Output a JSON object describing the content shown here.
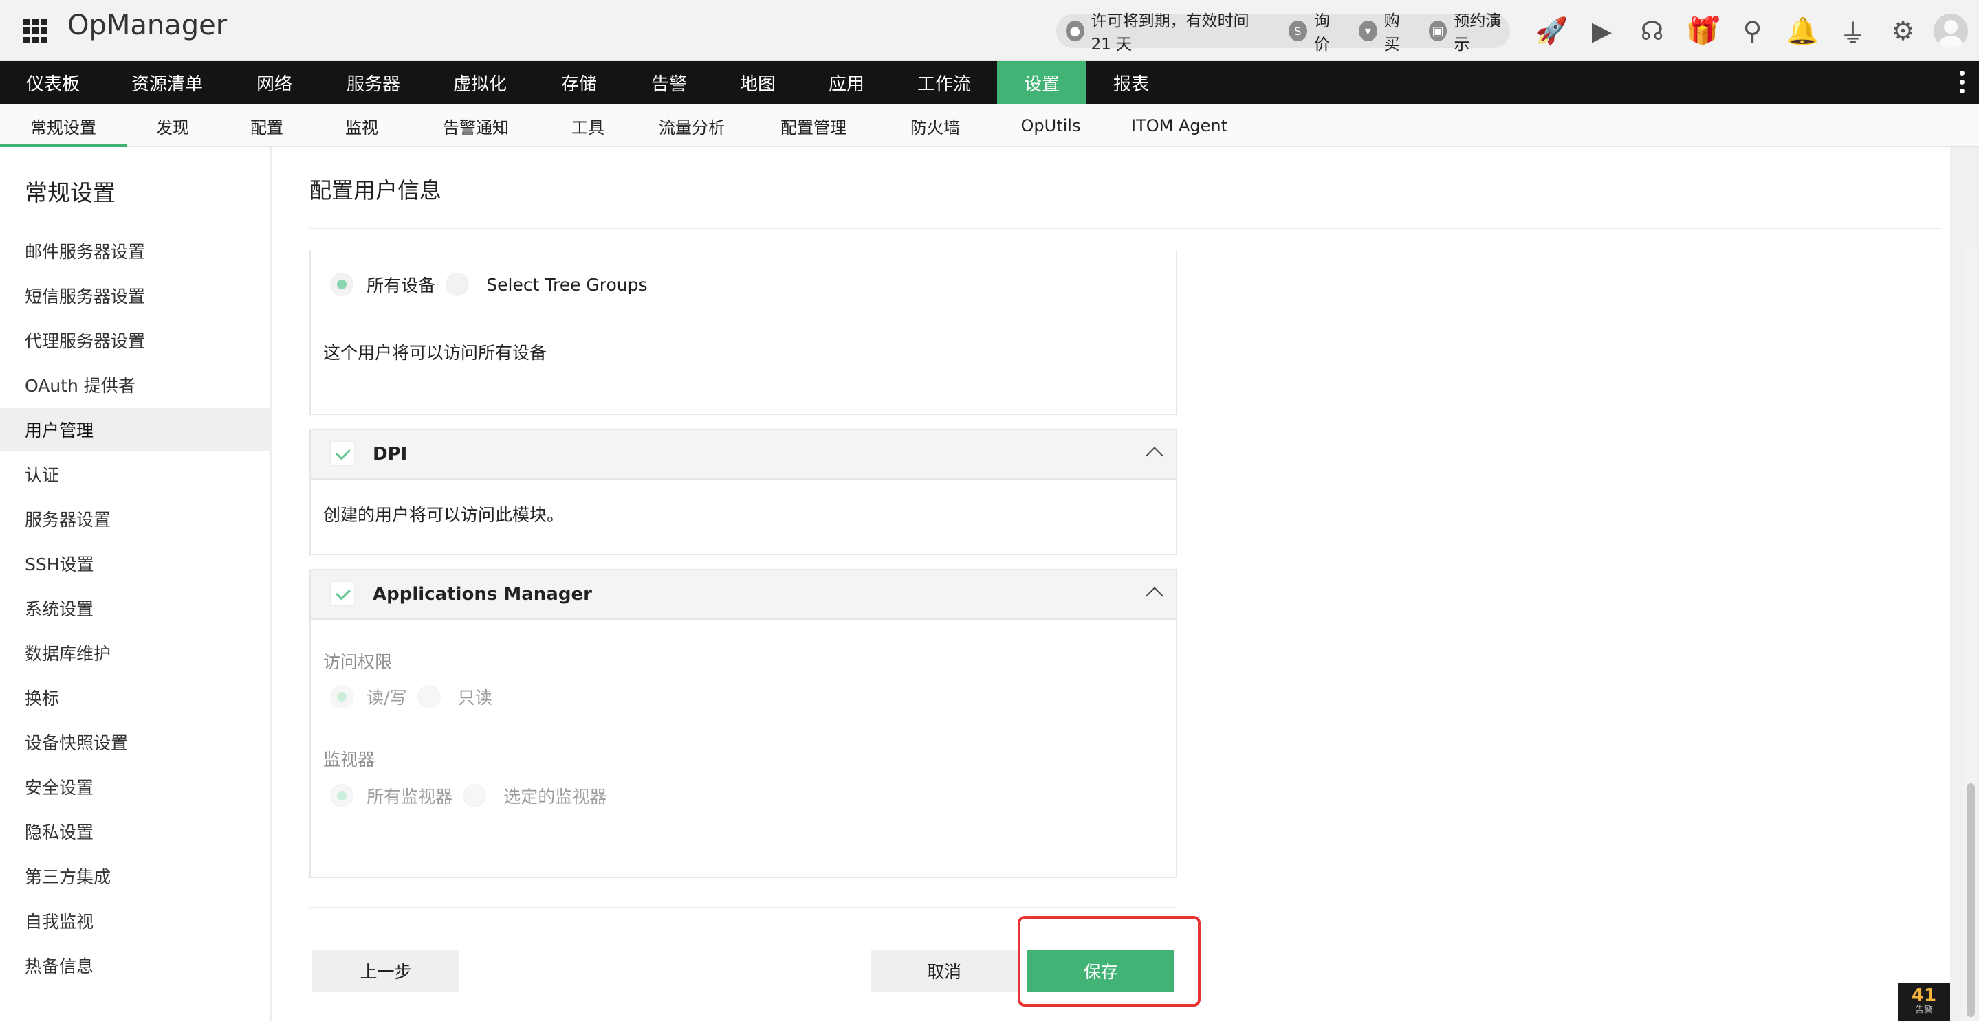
{
  "app": {
    "name": "OpManager"
  },
  "license": {
    "message": "许可将到期，有效时间 21 天",
    "links": [
      "询价",
      "购买",
      "预约演示"
    ],
    "icons": [
      "user-badge-icon",
      "dollar-icon",
      "cart-icon",
      "demo-icon"
    ]
  },
  "top_icons": [
    "rocket-icon",
    "presentation-icon",
    "headset-icon",
    "gift-icon",
    "search-icon",
    "bell-icon",
    "plug-icon",
    "gear-icon",
    "user-avatar-icon"
  ],
  "main_nav": [
    {
      "label": "仪表板",
      "w": 154
    },
    {
      "label": "资源清单",
      "w": 178
    },
    {
      "label": "网络",
      "w": 134
    },
    {
      "label": "服务器",
      "w": 154
    },
    {
      "label": "虚拟化",
      "w": 156
    },
    {
      "label": "存储",
      "w": 132
    },
    {
      "label": "告警",
      "w": 130
    },
    {
      "label": "地图",
      "w": 128
    },
    {
      "label": "应用",
      "w": 130
    },
    {
      "label": "工作流",
      "w": 154
    },
    {
      "label": "设置",
      "w": 130
    },
    {
      "label": "报表",
      "w": 130
    }
  ],
  "main_nav_active": "设置",
  "sub_nav": [
    "常规设置",
    "发现",
    "配置",
    "监视",
    "告警通知",
    "工具",
    "流量分析",
    "配置管理",
    "防火墙",
    "OpUtils",
    "ITOM Agent"
  ],
  "sub_nav_active": "常规设置",
  "sidebar": {
    "title": "常规设置",
    "items": [
      "邮件服务器设置",
      "短信服务器设置",
      "代理服务器设置",
      "OAuth 提供者",
      "用户管理",
      "认证",
      "服务器设置",
      "SSH设置",
      "系统设置",
      "数据库维护",
      "换标",
      "设备快照设置",
      "安全设置",
      "隐私设置",
      "第三方集成",
      "自我监视",
      "热备信息"
    ],
    "active": "用户管理"
  },
  "page": {
    "title": "配置用户信息",
    "device_scope": {
      "options": [
        "所有设备",
        "Select Tree Groups"
      ],
      "selected": "所有设备",
      "note": "这个用户将可以访问所有设备"
    },
    "dpi": {
      "label": "DPI",
      "checked": true,
      "note": "创建的用户将可以访问此模块。"
    },
    "apm": {
      "label": "Applications Manager",
      "checked": true,
      "access_label": "访问权限",
      "access_options": [
        "读/写",
        "只读"
      ],
      "access_selected": "读/写",
      "monitor_label": "监视器",
      "monitor_options": [
        "所有监视器",
        "选定的监视器"
      ],
      "monitor_selected": "所有监视器"
    }
  },
  "buttons": {
    "back": "上一步",
    "cancel": "取消",
    "save": "保存"
  },
  "alarm_badge": {
    "count": "41",
    "label": "告警"
  },
  "colors": {
    "accent": "#41b475",
    "nav_bg": "#141414",
    "highlight": "#e53535"
  }
}
